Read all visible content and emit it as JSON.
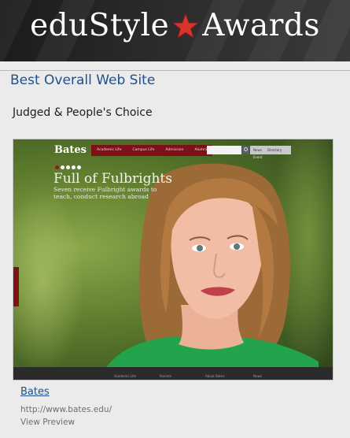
{
  "header": {
    "brand_left": "eduStyle",
    "brand_right": "Awards",
    "star_icon": "star-icon",
    "star_color": "#d9342b",
    "background": "#232323"
  },
  "award": {
    "category": "Best Overall Web Site",
    "subcategory": "Judged & People's Choice"
  },
  "screenshot": {
    "logo": "Bates",
    "nav": [
      "Academic Life",
      "Campus Life",
      "Admission",
      "Alumni"
    ],
    "quick_links": [
      "News",
      "Directory"
    ],
    "event_label": "Event",
    "headline": "Full of Fulbrights",
    "subhead": "Seven receive Fulbright awards to teach, conduct research abroad",
    "footer_columns": [
      "Academic Life",
      "Parents",
      "About Bates",
      "News"
    ],
    "nav_color": "#7d1117"
  },
  "entry": {
    "site_name": "Bates",
    "url": "http://www.bates.edu/",
    "preview_label": "View Preview"
  }
}
